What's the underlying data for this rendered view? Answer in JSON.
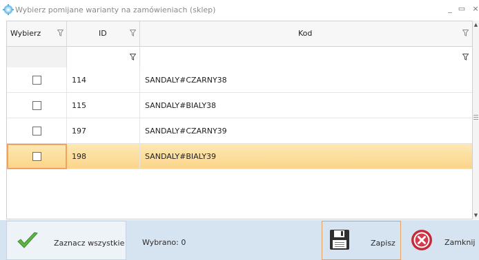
{
  "window": {
    "title": "Wybierz pomijane warianty na zamówieniach (sklep)",
    "minimize_glyph": "_",
    "maximize_glyph": "▭",
    "close_glyph": "×",
    "icon": "gear-icon"
  },
  "grid": {
    "columns": [
      {
        "label": "Wybierz",
        "filter_icon": "filter-icon"
      },
      {
        "label": "ID",
        "filter_icon": "filter-icon"
      },
      {
        "label": "Kod",
        "filter_icon": "filter-icon"
      }
    ],
    "rows": [
      {
        "checked": false,
        "id": "114",
        "kod": "SANDALY#CZARNY38",
        "selected": false
      },
      {
        "checked": false,
        "id": "115",
        "kod": "SANDALY#BIALY38",
        "selected": false
      },
      {
        "checked": false,
        "id": "197",
        "kod": "SANDALY#CZARNY39",
        "selected": false
      },
      {
        "checked": false,
        "id": "198",
        "kod": "SANDALY#BIALY39",
        "selected": true
      }
    ],
    "selected_row_color": "#fbd58a",
    "focus_color": "#f1a35a"
  },
  "footer": {
    "select_all_label": "Zaznacz wszystkie",
    "select_all_icon": "checkmark-icon",
    "status_text": "Wybrano: 0",
    "save_label": "Zapisz",
    "save_icon": "floppy-disk-icon",
    "close_label": "Zamknij",
    "close_icon": "close-circle-icon",
    "background_color": "#d6e3f1"
  }
}
